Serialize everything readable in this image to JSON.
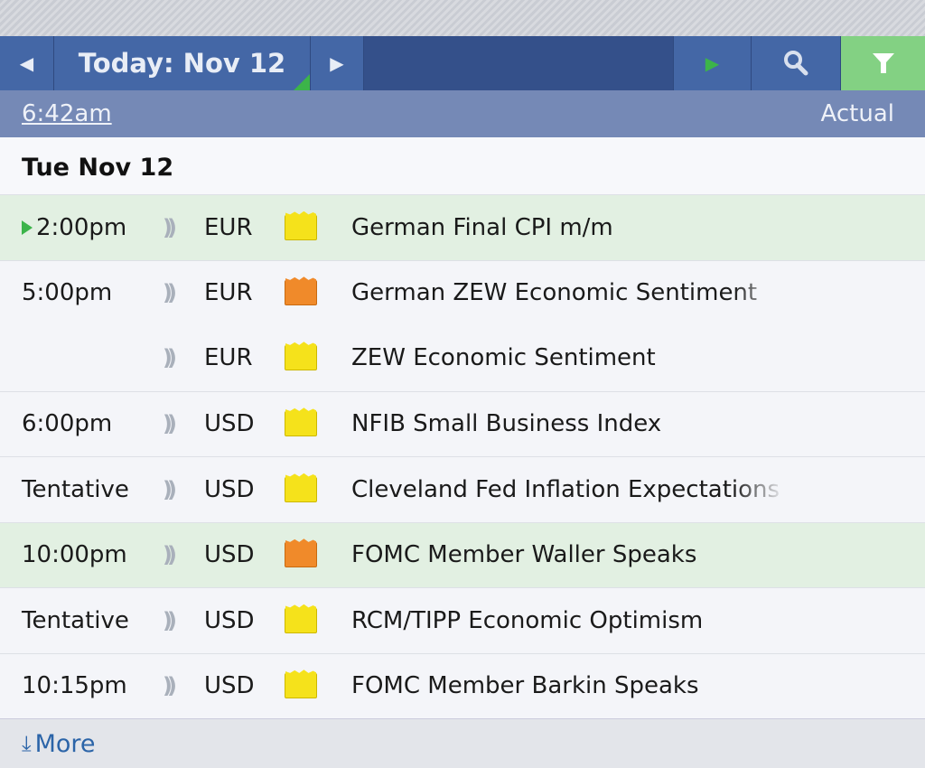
{
  "toolbar": {
    "prev_icon": "chevron-left-icon",
    "title": "Today: Nov 12",
    "next_icon": "chevron-right-icon",
    "play_icon": "play-icon",
    "search_icon": "search-icon",
    "filter_icon": "filter-icon",
    "filter_color": "#83d183"
  },
  "subheader": {
    "time": "6:42am",
    "actual_label": "Actual"
  },
  "day": "Tue Nov 12",
  "events": [
    {
      "time": "2:00pm",
      "currency": "EUR",
      "impact": "low",
      "title": "German Final CPI m/m",
      "highlight": true,
      "next": true
    },
    {
      "time": "5:00pm",
      "currency": "EUR",
      "impact": "medium",
      "title": "German ZEW Economic Sentiment"
    },
    {
      "time": "",
      "currency": "EUR",
      "impact": "low",
      "title": "ZEW Economic Sentiment"
    },
    {
      "time": "6:00pm",
      "currency": "USD",
      "impact": "low",
      "title": "NFIB Small Business Index"
    },
    {
      "time": "Tentative",
      "currency": "USD",
      "impact": "low",
      "title": "Cleveland Fed Inflation Expectations"
    },
    {
      "time": "10:00pm",
      "currency": "USD",
      "impact": "medium",
      "title": "FOMC Member Waller Speaks",
      "highlight": true
    },
    {
      "time": "Tentative",
      "currency": "USD",
      "impact": "low",
      "title": "RCM/TIPP Economic Optimism"
    },
    {
      "time": "10:15pm",
      "currency": "USD",
      "impact": "low",
      "title": "FOMC Member Barkin Speaks"
    }
  ],
  "more": {
    "icon": "download-arrow-icon",
    "label": "More"
  }
}
